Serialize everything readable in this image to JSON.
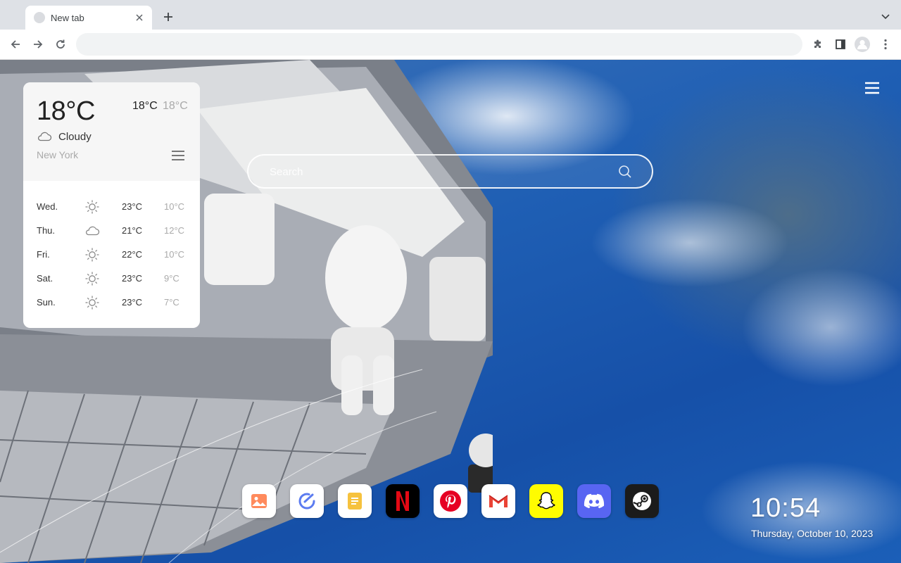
{
  "browser": {
    "tab_title": "New tab",
    "omnibox_value": ""
  },
  "weather": {
    "current_temp": "18°C",
    "high": "18°C",
    "low": "18°C",
    "condition": "Cloudy",
    "condition_icon": "cloud-icon",
    "city": "New York",
    "forecast": [
      {
        "day": "Wed.",
        "icon": "sun-icon",
        "high": "23°C",
        "low": "10°C"
      },
      {
        "day": "Thu.",
        "icon": "cloud-icon",
        "high": "21°C",
        "low": "12°C"
      },
      {
        "day": "Fri.",
        "icon": "sun-icon",
        "high": "22°C",
        "low": "10°C"
      },
      {
        "day": "Sat.",
        "icon": "sun-icon",
        "high": "23°C",
        "low": "9°C"
      },
      {
        "day": "Sun.",
        "icon": "sun-icon",
        "high": "23°C",
        "low": "7°C"
      }
    ]
  },
  "search": {
    "placeholder": "Search"
  },
  "dock": {
    "apps": [
      {
        "name": "photos",
        "icon": "photo-icon",
        "color": "#ffffff"
      },
      {
        "name": "tasks",
        "icon": "check-circle-icon",
        "color": "#ffffff"
      },
      {
        "name": "notes",
        "icon": "notes-icon",
        "color": "#ffffff"
      },
      {
        "name": "netflix",
        "icon": "netflix-icon",
        "color": "#000000"
      },
      {
        "name": "pinterest",
        "icon": "pinterest-icon",
        "color": "#ffffff"
      },
      {
        "name": "gmail",
        "icon": "gmail-icon",
        "color": "#ffffff"
      },
      {
        "name": "snapchat",
        "icon": "snapchat-icon",
        "color": "#fffc00"
      },
      {
        "name": "discord",
        "icon": "discord-icon",
        "color": "#5865f2"
      },
      {
        "name": "steam",
        "icon": "steam-icon",
        "color": "#1b1b1b"
      }
    ]
  },
  "clock": {
    "time": "10:54",
    "date": "Thursday, October 10, 2023"
  }
}
